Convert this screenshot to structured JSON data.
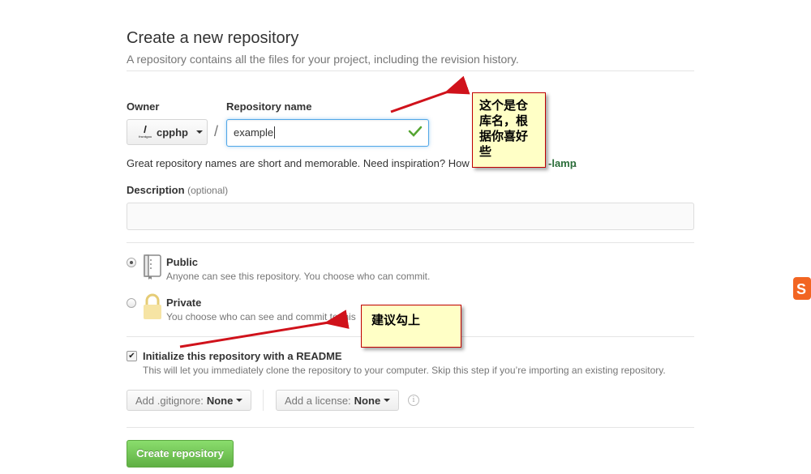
{
  "header": {
    "title": "Create a new repository",
    "subtitle": "A repository contains all the files for your project, including the revision history."
  },
  "owner": {
    "label": "Owner",
    "value": "cpphp"
  },
  "repo_name": {
    "label": "Repository name",
    "value": "example",
    "separator": "/"
  },
  "hint": {
    "text": "Great repository names are short and memorable. Need inspiration? How",
    "suggestion": "-lamp",
    "trailing": "."
  },
  "description": {
    "label": "Description",
    "optional": "(optional)",
    "value": ""
  },
  "visibility": {
    "public": {
      "title": "Public",
      "desc": "Anyone can see this repository. You choose who can commit.",
      "selected": true
    },
    "private": {
      "title": "Private",
      "desc": "You choose who can see and commit to this",
      "selected": false
    }
  },
  "readme": {
    "title": "Initialize this repository with a README",
    "desc": "This will let you immediately clone the repository to your computer. Skip this step if you’re importing an existing repository.",
    "checked": true
  },
  "gitignore": {
    "label": "Add .gitignore:",
    "value": "None"
  },
  "license": {
    "label": "Add a license:",
    "value": "None"
  },
  "create_button": "Create repository",
  "annotations": {
    "note1": "这个是仓库名，根据你喜好些",
    "note2": "建议勾上"
  },
  "colors": {
    "primary_button": "#60b044",
    "focus_border": "#51a7e8",
    "success_check": "#55a532",
    "annotation_bg": "#ffffc6",
    "annotation_border": "#c00000",
    "annotation_arrow": "#d0121b"
  }
}
